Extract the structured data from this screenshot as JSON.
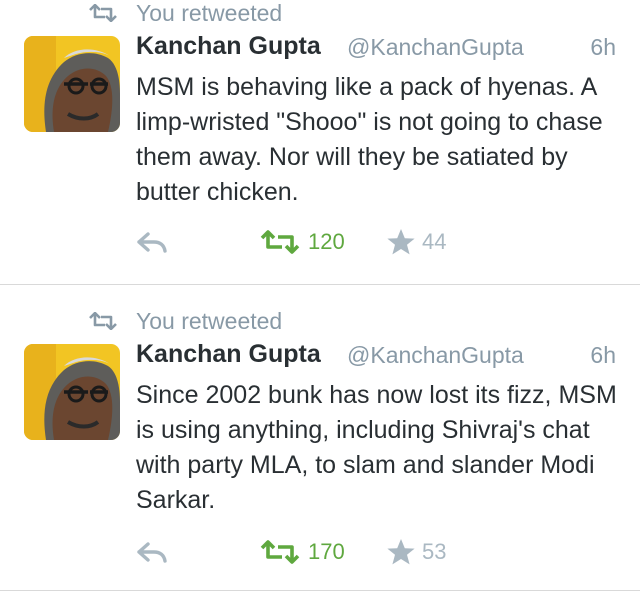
{
  "tweets": [
    {
      "context_label": "You retweeted",
      "author_name": "Kanchan Gupta",
      "author_handle": "@KanchanGupta",
      "timestamp": "6h",
      "text": "MSM is behaving like a pack of hyenas. A limp-wristed \"Shooo\" is not going to chase them away. Nor will they be satiated by butter chicken.",
      "retweet_count": "120",
      "favorite_count": "44",
      "retweeted": true
    },
    {
      "context_label": "You retweeted",
      "author_name": "Kanchan Gupta",
      "author_handle": "@KanchanGupta",
      "timestamp": "6h",
      "text": "Since 2002 bunk has now lost its fizz, MSM is using anything, including Shivraj's chat with party MLA, to slam and slander Modi Sarkar.",
      "retweet_count": "170",
      "favorite_count": "53",
      "retweeted": true
    }
  ],
  "icons": {
    "retweet_context": "retweet-icon",
    "reply": "reply-icon",
    "retweet": "retweet-icon",
    "favorite": "star-icon"
  },
  "colors": {
    "retweet_active": "#5fa83f",
    "muted": "#8899a6",
    "icon_gray": "#aab8c2",
    "text": "#292f33"
  }
}
